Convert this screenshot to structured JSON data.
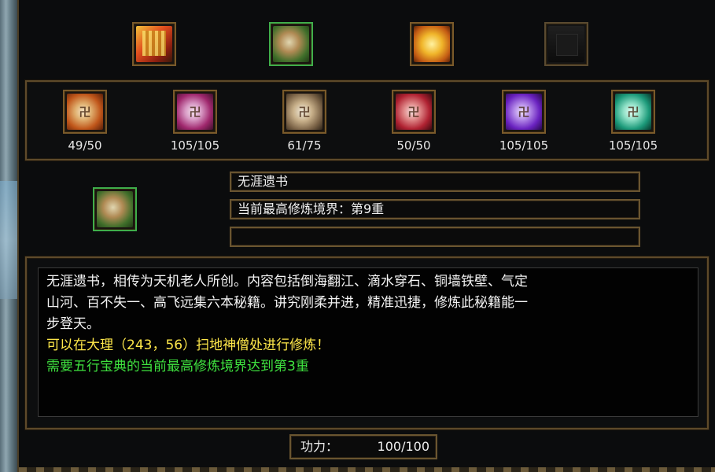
{
  "top_slots": [
    {
      "icon": "book-icon",
      "selected": false
    },
    {
      "icon": "scroll-bundle-icon",
      "selected": true
    },
    {
      "icon": "gold-scroll-bundle-icon",
      "selected": false
    },
    {
      "icon": "empty-slot-icon",
      "selected": false
    }
  ],
  "sub_items": [
    {
      "icon": "orange-scroll-icon",
      "count": "49/50"
    },
    {
      "icon": "pink-scroll-icon",
      "count": "105/105"
    },
    {
      "icon": "tan-scroll-icon",
      "count": "61/75"
    },
    {
      "icon": "red-scroll-icon",
      "count": "50/50"
    },
    {
      "icon": "purple-scroll-icon",
      "count": "105/105"
    },
    {
      "icon": "teal-scroll-icon",
      "count": "105/105"
    }
  ],
  "detail": {
    "icon": "scroll-bundle-icon",
    "name": "无涯遗书",
    "realm": "当前最高修炼境界：第9重",
    "extra": ""
  },
  "description": {
    "line1": "无涯遗书，相传为天机老人所创。内容包括倒海翻江、滴水穿石、铜墙铁壁、气定",
    "line2": "山河、百不失一、高飞远集六本秘籍。讲究刚柔并进，精准迅捷，修炼此秘籍能一",
    "line3": "步登天。",
    "location": "可以在大理（243，56）扫地神僧处进行修炼！",
    "requirement": "需要五行宝典的当前最高修炼境界达到第3重"
  },
  "power": {
    "label": "功力：",
    "value": "100/100"
  },
  "colors": {
    "frame": "#5e4a2a",
    "yellow_text": "#ffe84a",
    "green_text": "#3fe23f",
    "selected_border": "#3fae4a"
  }
}
